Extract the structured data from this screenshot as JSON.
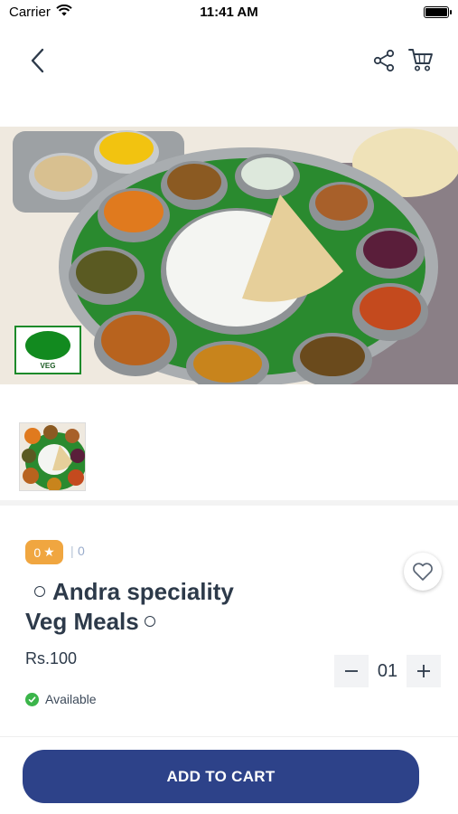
{
  "status_bar": {
    "carrier": "Carrier",
    "time": "11:41 AM"
  },
  "nav": {
    "back_icon": "chevron-left-icon",
    "share_icon": "share-icon",
    "cart_icon": "cart-icon"
  },
  "product": {
    "badge_text": "VEG",
    "rating_value": "0",
    "rating_count": "0",
    "title_line1": "Andra speciality",
    "title_line2": "Veg Meals",
    "price": "Rs.100",
    "quantity": "01",
    "availability": "Available",
    "favorite_icon": "heart-icon"
  },
  "actions": {
    "add_to_cart": "ADD TO CART"
  },
  "colors": {
    "primary": "#2d4289",
    "rating": "#f0a640",
    "available": "#3bb54a",
    "veg_green": "#128a1f"
  }
}
